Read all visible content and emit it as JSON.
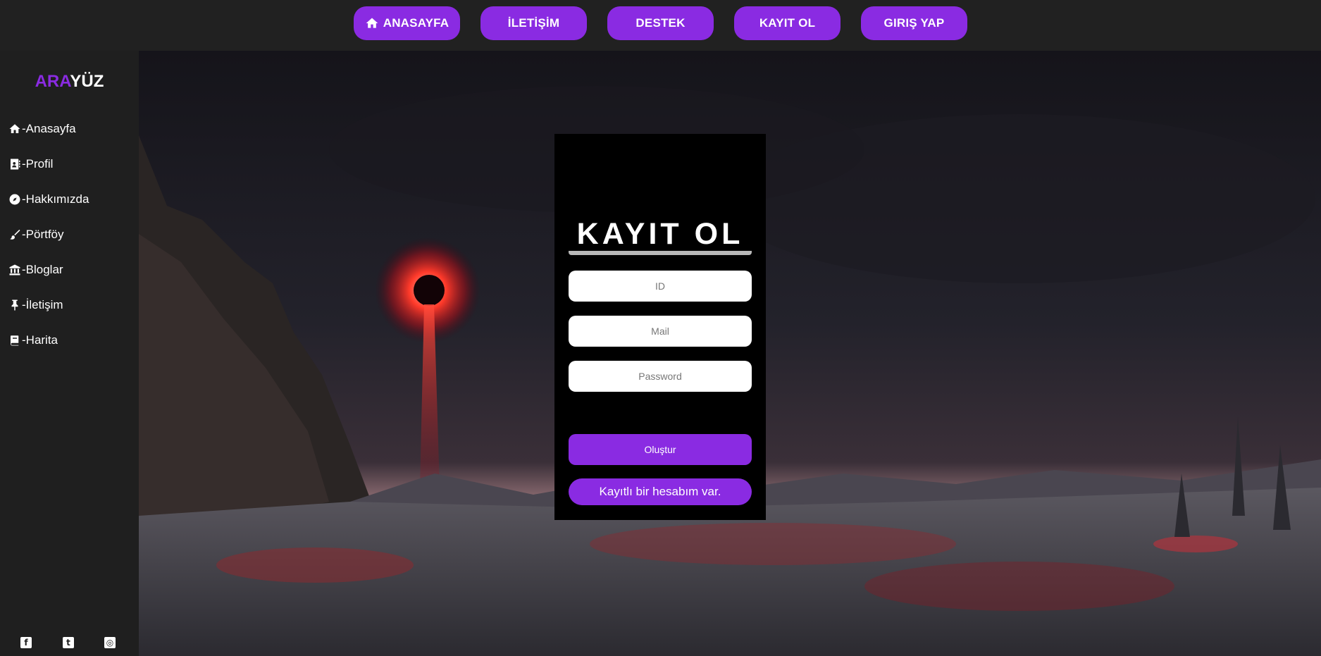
{
  "topnav": {
    "items": [
      {
        "label": "ANASAYFA",
        "icon": "home-icon"
      },
      {
        "label": "İLETİŞİM"
      },
      {
        "label": "DESTEK"
      },
      {
        "label": "KAYIT OL"
      },
      {
        "label": "GIRIŞ YAP"
      }
    ]
  },
  "sidebar": {
    "logo": {
      "part1": "ARA",
      "part2": "YÜZ"
    },
    "items": [
      {
        "label": "-Anasayfa",
        "icon": "home-icon"
      },
      {
        "label": "-Profil",
        "icon": "address-card-icon"
      },
      {
        "label": "-Hakkımızda",
        "icon": "compass-icon"
      },
      {
        "label": "-Pörtföy",
        "icon": "brush-icon"
      },
      {
        "label": "-Bloglar",
        "icon": "bank-icon"
      },
      {
        "label": "-İletişim",
        "icon": "pushpin-icon"
      },
      {
        "label": "-Harita",
        "icon": "book-icon"
      }
    ],
    "social": [
      {
        "icon": "facebook-icon",
        "glyph": "f"
      },
      {
        "icon": "twitter-icon",
        "glyph": "t"
      },
      {
        "icon": "instagram-icon",
        "glyph": "◎"
      }
    ]
  },
  "form": {
    "title": "KAYIT OL",
    "id_placeholder": "ID",
    "mail_placeholder": "Mail",
    "password_placeholder": "Password",
    "create_label": "Oluştur",
    "login_label": "Kayıtlı bir hesabım var."
  },
  "colors": {
    "accent": "#8a2be2",
    "logo_accent": "#8a2be2",
    "topbar_bg": "#212121",
    "sidebar_bg": "#1f1f1f",
    "panel_bg": "#000000"
  }
}
